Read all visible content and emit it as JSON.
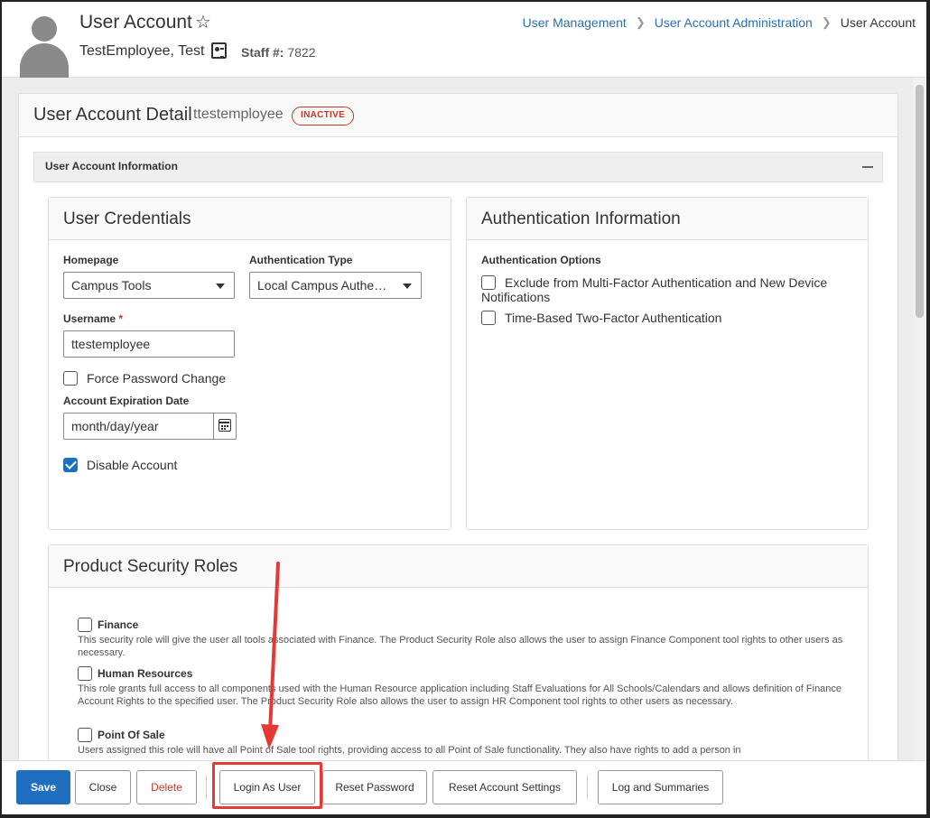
{
  "header": {
    "title": "User Account",
    "person_name": "TestEmployee, Test",
    "staff_label": "Staff #:",
    "staff_number": "7822",
    "breadcrumb": [
      "User Management",
      "User Account Administration",
      "User Account"
    ]
  },
  "detail": {
    "title": "User Account Detail",
    "username": "ttestemployee",
    "status": "INACTIVE",
    "section_title": "User Account Information"
  },
  "credentials": {
    "title": "User Credentials",
    "homepage_label": "Homepage",
    "homepage_value": "Campus Tools",
    "auth_type_label": "Authentication Type",
    "auth_type_value": "Local Campus Authen…",
    "username_label": "Username",
    "required_mark": "*",
    "username_value": "ttestemployee",
    "force_password_label": "Force Password Change",
    "force_password_checked": false,
    "expiration_label": "Account Expiration Date",
    "expiration_placeholder": "month/day/year",
    "disable_label": "Disable Account",
    "disable_checked": true
  },
  "authentication": {
    "title": "Authentication Information",
    "options_label": "Authentication Options",
    "options": [
      {
        "label": "Exclude from Multi-Factor Authentication and New Device Notifications",
        "checked": false
      },
      {
        "label": "Time-Based Two-Factor Authentication",
        "checked": false
      }
    ]
  },
  "roles": {
    "title": "Product Security Roles",
    "items": [
      {
        "name": "Finance",
        "description": "This security role will give the user all tools associated with Finance. The Product Security Role also allows the user to assign Finance Component tool rights to other users as necessary."
      },
      {
        "name": "Human Resources",
        "description": "This role grants full access to all components used with the Human Resource application including Staff Evaluations for All Schools/Calendars and allows definition of Finance Account Rights to the specified user. The Product Security Role also allows the user to assign HR Component tool rights to other users as necessary."
      },
      {
        "name": "Point Of Sale",
        "description": "Users assigned this role will have all Point of Sale tool rights, providing access to all Point of Sale functionality. They also have rights to add a person in"
      }
    ]
  },
  "toolbar": {
    "save": "Save",
    "close": "Close",
    "delete": "Delete",
    "login_as_user": "Login As User",
    "reset_password": "Reset Password",
    "reset_account_settings": "Reset Account Settings",
    "log_and_summaries": "Log and Summaries"
  },
  "colors": {
    "primary": "#1e6fbf",
    "danger": "#c0392b",
    "annotation": "#e53935",
    "link": "#2a6fb0"
  }
}
